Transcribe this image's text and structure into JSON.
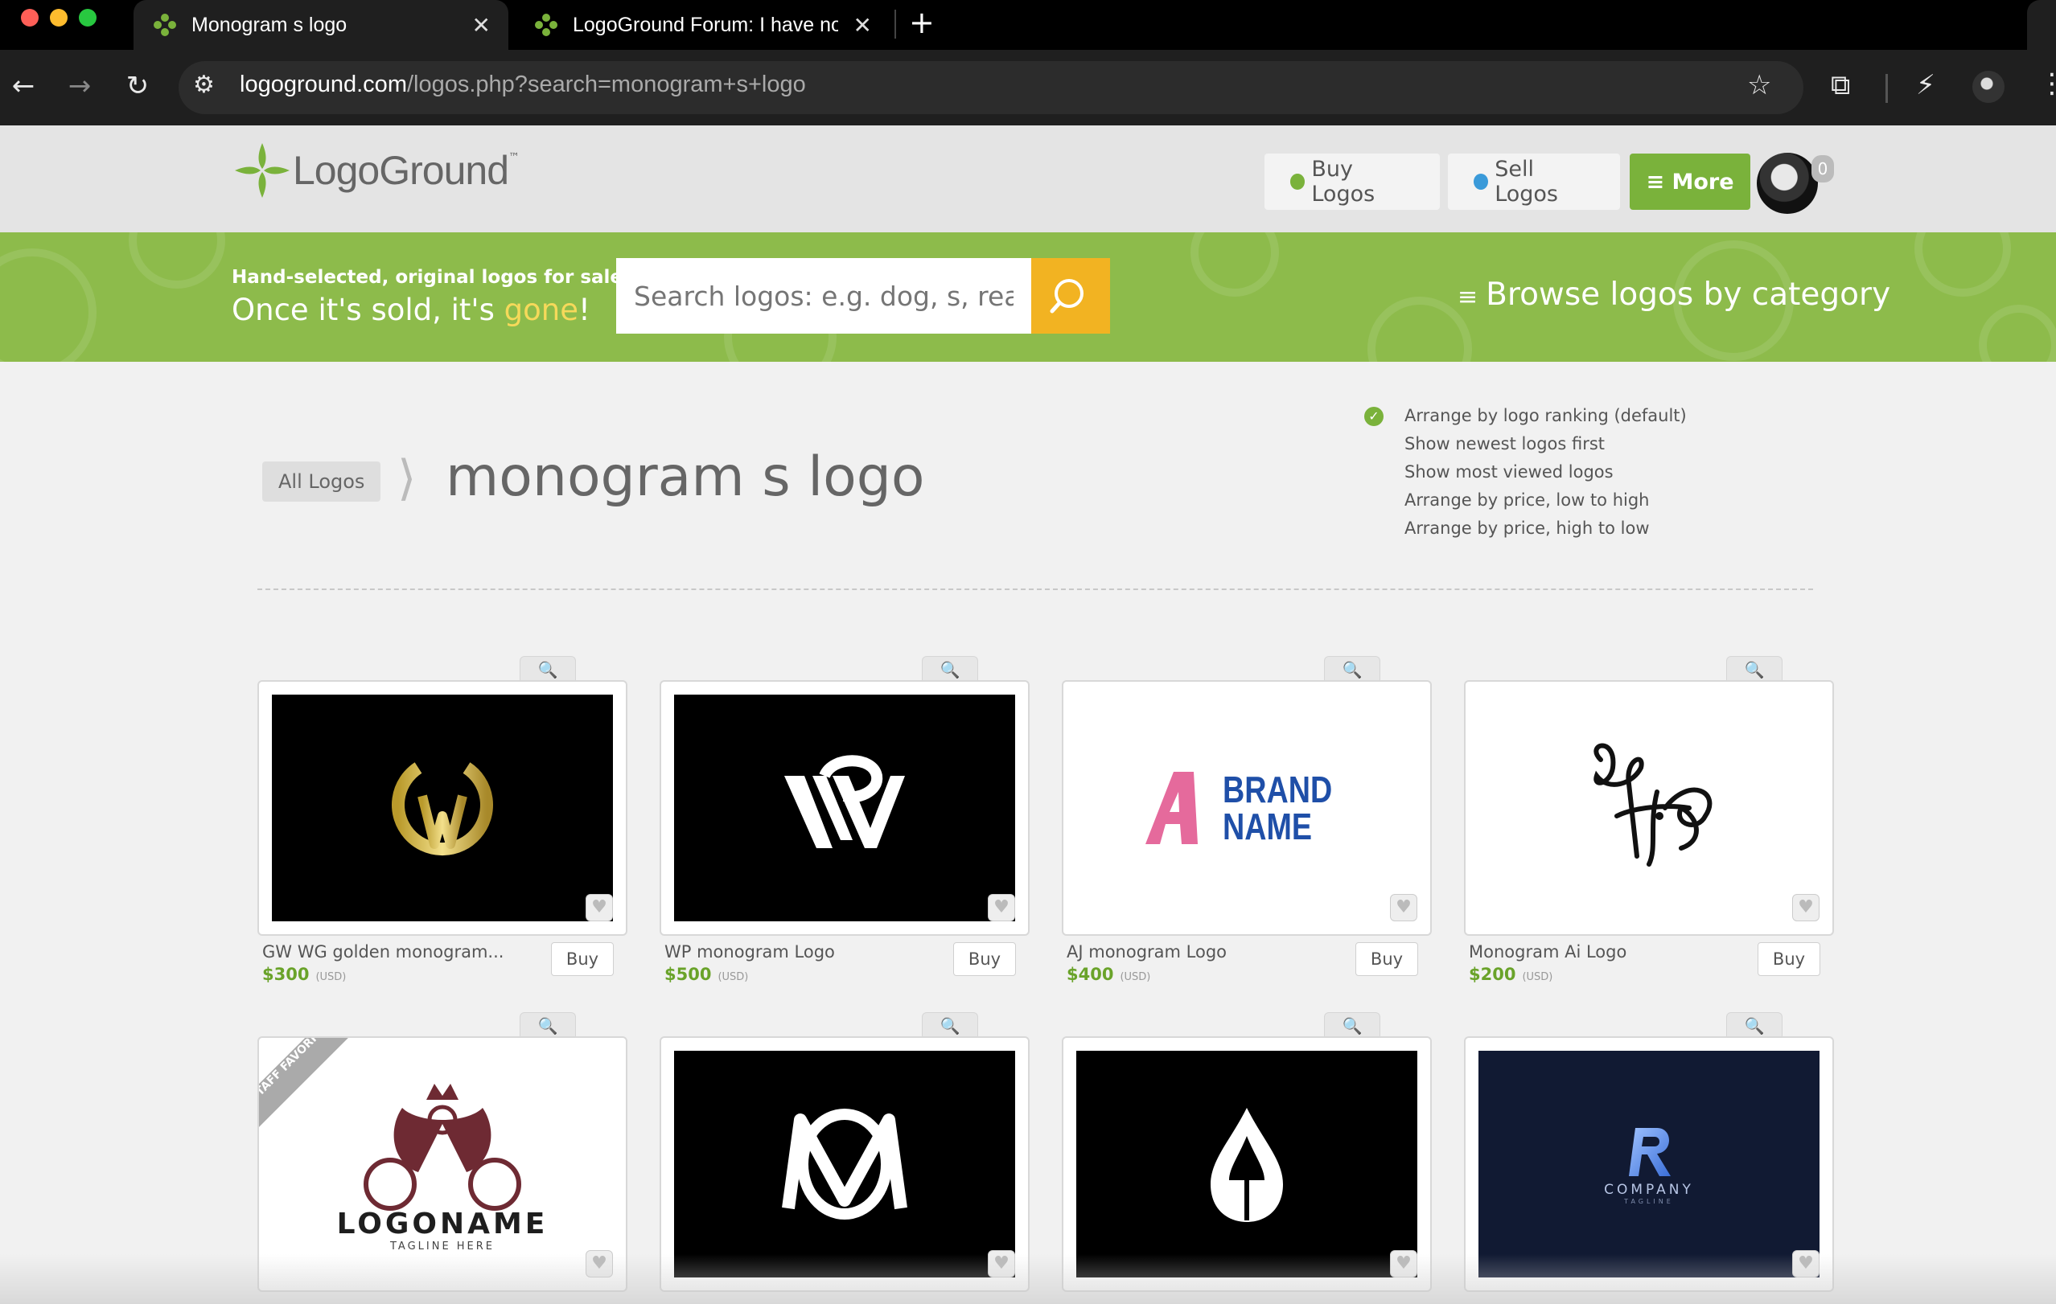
{
  "browser": {
    "tabs": [
      {
        "title": "Monogram s logo",
        "active": true
      },
      {
        "title": "LogoGround Forum: I have no",
        "active": false
      }
    ],
    "new_tab": "+",
    "url_domain": "logoground.com",
    "url_path": "/logos.php?search=monogram+s+logo"
  },
  "header": {
    "logo_text": "LogoGround",
    "logo_tm": "™",
    "buy_logos": "Buy Logos",
    "sell_logos": "Sell Logos",
    "more": "≡ More",
    "notification_count": "0"
  },
  "banner": {
    "tagline_small": "Hand-selected, original logos for sale",
    "tagline_prefix": "Once it's sold, it's ",
    "tagline_highlight": "gone",
    "tagline_suffix": "!",
    "search_placeholder": "Search logos: e.g. dog, s, real e",
    "browse": "Browse logos by category"
  },
  "breadcrumb": {
    "all_logos": "All Logos",
    "separator": "⟩",
    "title": "monogram s logo"
  },
  "sort_options": [
    {
      "label": "Arrange by logo ranking (default)",
      "selected": true
    },
    {
      "label": "Show newest logos first",
      "selected": false
    },
    {
      "label": "Show most viewed logos",
      "selected": false
    },
    {
      "label": "Arrange by price, low to high",
      "selected": false
    },
    {
      "label": "Arrange by price, high to low",
      "selected": false
    }
  ],
  "logos": [
    {
      "name": "GW WG golden monogram...",
      "price": "$300",
      "currency": "(USD)",
      "buy": "Buy"
    },
    {
      "name": "WP monogram Logo",
      "price": "$500",
      "currency": "(USD)",
      "buy": "Buy"
    },
    {
      "name": "AJ monogram Logo",
      "price": "$400",
      "currency": "(USD)",
      "buy": "Buy",
      "thumb_text": [
        "BRAND",
        "NAME"
      ]
    },
    {
      "name": "Monogram Ai Logo",
      "price": "$200",
      "currency": "(USD)",
      "buy": "Buy"
    },
    {
      "ribbon": "STAFF FAVORITE",
      "thumb_text": [
        "LOGONAME",
        "TAGLINE HERE"
      ]
    },
    {},
    {},
    {
      "thumb_text": [
        "COMPANY",
        "TAGLINE"
      ]
    }
  ],
  "colors": {
    "brand_green": "#7ab23b",
    "banner_green": "#8dbb4b",
    "search_orange": "#f2b322",
    "price_green": "#6aa32a"
  }
}
